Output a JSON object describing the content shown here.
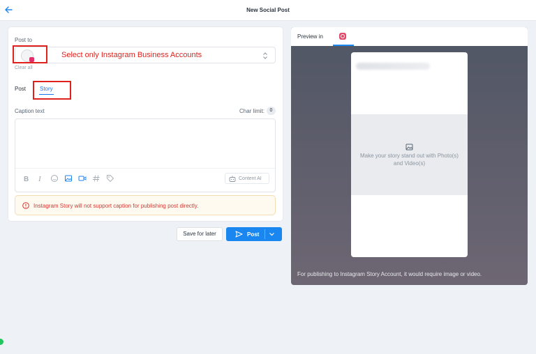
{
  "header": {
    "title": "New Social Post"
  },
  "post_to": {
    "label": "Post to",
    "annotation": "Select only Instagram Business Accounts",
    "clear_all": "Clear all"
  },
  "tabs": [
    {
      "label": "Post",
      "active": false
    },
    {
      "label": "Story",
      "active": true
    }
  ],
  "caption": {
    "label": "Caption text",
    "char_limit_label": "Char limit:",
    "char_count": "0",
    "value": ""
  },
  "toolbar": {
    "icons": [
      "bold-icon",
      "italic-icon",
      "emoji-icon",
      "image-icon",
      "video-icon",
      "hashtag-icon",
      "tag-icon"
    ],
    "content_ai_label": "Content AI"
  },
  "warning": {
    "text": "Instagram Story will not support caption for publishing post directly."
  },
  "actions": {
    "save_label": "Save for later",
    "post_label": "Post"
  },
  "preview": {
    "label": "Preview in",
    "placeholder": "Make your story stand out with Photo(s) and Video(s)",
    "footer": "For publishing to Instagram Story Account, it would require image or video."
  },
  "colors": {
    "accent": "#1a86f0",
    "annotation": "#e0201b",
    "warning_text": "#d1362f"
  }
}
